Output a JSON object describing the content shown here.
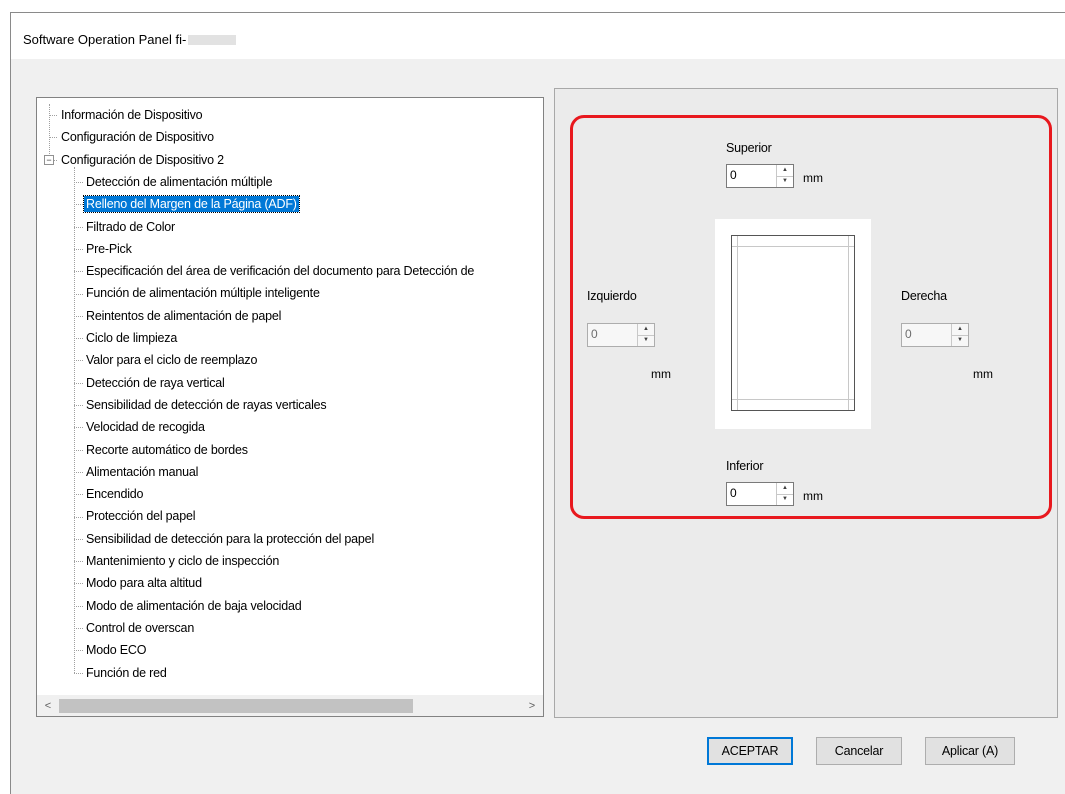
{
  "window": {
    "title": "Software Operation Panel fi-"
  },
  "tree": {
    "nodes": [
      {
        "label": "Información de Dispositivo",
        "level": 0
      },
      {
        "label": "Configuración de Dispositivo",
        "level": 0
      },
      {
        "label": "Configuración de Dispositivo 2",
        "level": 0,
        "expanded": true,
        "expander": "⊟"
      },
      {
        "label": "Detección de alimentación múltiple",
        "level": 1
      },
      {
        "label": "Relleno del Margen de la Página (ADF)",
        "level": 1,
        "selected": true
      },
      {
        "label": "Filtrado de Color",
        "level": 1
      },
      {
        "label": "Pre-Pick",
        "level": 1
      },
      {
        "label": "Especificación del área de verificación del documento para Detección de",
        "level": 1
      },
      {
        "label": "Función de alimentación múltiple inteligente",
        "level": 1
      },
      {
        "label": "Reintentos de alimentación de papel",
        "level": 1
      },
      {
        "label": "Ciclo de limpieza",
        "level": 1
      },
      {
        "label": "Valor para el ciclo de reemplazo",
        "level": 1
      },
      {
        "label": "Detección de raya vertical",
        "level": 1
      },
      {
        "label": "Sensibilidad de detección de rayas verticales",
        "level": 1
      },
      {
        "label": "Velocidad de recogida",
        "level": 1
      },
      {
        "label": "Recorte automático de bordes",
        "level": 1
      },
      {
        "label": "Alimentación manual",
        "level": 1
      },
      {
        "label": "Encendido",
        "level": 1
      },
      {
        "label": "Protección del papel",
        "level": 1
      },
      {
        "label": "Sensibilidad de detección para la protección del papel",
        "level": 1
      },
      {
        "label": "Mantenimiento y ciclo de inspección",
        "level": 1
      },
      {
        "label": "Modo para alta altitud",
        "level": 1
      },
      {
        "label": "Modo de alimentación de baja velocidad",
        "level": 1
      },
      {
        "label": "Control de overscan",
        "level": 1
      },
      {
        "label": "Modo ECO",
        "level": 1
      },
      {
        "label": "Función de red",
        "level": 1
      }
    ],
    "scroll_left": "<",
    "scroll_right": ">"
  },
  "margins": {
    "top": {
      "label": "Superior",
      "value": "0",
      "unit": "mm"
    },
    "left": {
      "label": "Izquierdo",
      "value": "0",
      "unit": "mm"
    },
    "right": {
      "label": "Derecha",
      "value": "0",
      "unit": "mm"
    },
    "bottom": {
      "label": "Inferior",
      "value": "0",
      "unit": "mm"
    },
    "spin_up": "▲",
    "spin_down": "▼"
  },
  "buttons": {
    "ok": "ACEPTAR",
    "cancel": "Cancelar",
    "apply": "Aplicar (A)"
  },
  "colors": {
    "selection": "#0078d7",
    "highlight_border": "#e8181e"
  }
}
